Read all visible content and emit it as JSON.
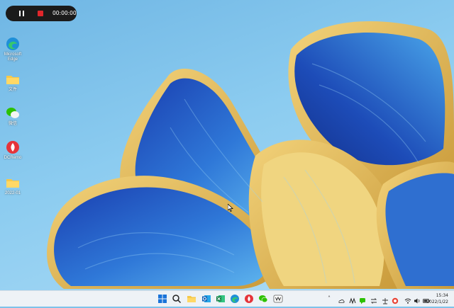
{
  "recorder": {
    "timer": "00:00:00"
  },
  "desktop_icons": [
    {
      "label": "Microsoft Edge",
      "label_line1": "Microsoft",
      "label_line2": "Edge",
      "icon": "edge-icon"
    },
    {
      "label": "文件",
      "icon": "folder-icon"
    },
    {
      "label": "微信",
      "icon": "wechat-icon"
    },
    {
      "label": "DCRemo",
      "icon": "dcremote-icon"
    },
    {
      "label": "2022-01",
      "icon": "folder-icon"
    }
  ],
  "taskbar": {
    "apps": [
      "windows-start-icon",
      "search-icon",
      "file-explorer-icon",
      "outlook-icon",
      "excel-icon",
      "edge-icon",
      "pdf-app-icon",
      "wechat-icon",
      "screen-recorder-icon"
    ],
    "tray_icons": [
      "chevron-up-icon",
      "cloud-icon",
      "app-icon",
      "chat-icon",
      "wifi-icon",
      "volume-icon",
      "battery-icon"
    ],
    "time": "15:34",
    "date": "2022/1/22"
  },
  "colors": {
    "accent_blue": "#1f4fb5",
    "accent_gold": "#e8c35e",
    "sky": "#8cccf0"
  }
}
